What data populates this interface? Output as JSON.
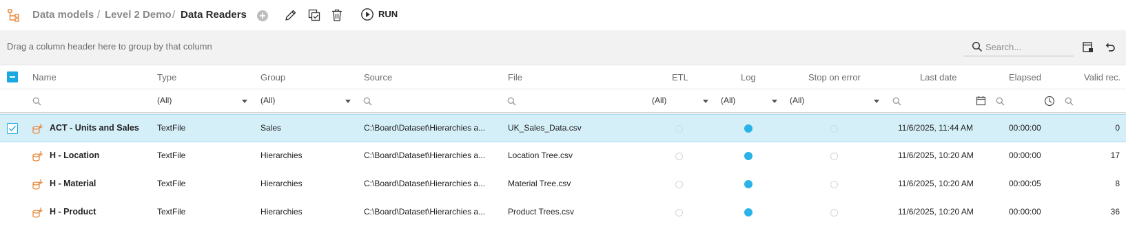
{
  "breadcrumb": {
    "items": [
      "Data models",
      "Level 2 Demo",
      "Data Readers"
    ],
    "separator": "/"
  },
  "toolbar": {
    "run_label": "RUN"
  },
  "groupbar": {
    "hint": "Drag a column header here to group by that column",
    "search_placeholder": "Search..."
  },
  "columns": {
    "name": "Name",
    "type": "Type",
    "group": "Group",
    "source": "Source",
    "file": "File",
    "etl": "ETL",
    "log": "Log",
    "stop_on_error": "Stop on error",
    "last_date": "Last date",
    "elapsed": "Elapsed",
    "valid_rec": "Valid rec."
  },
  "filters": {
    "type": "(All)",
    "group": "(All)",
    "etl": "(All)",
    "log": "(All)",
    "stop_on_error": "(All)"
  },
  "rows": [
    {
      "name": "ACT - Units and Sales",
      "type": "TextFile",
      "group": "Sales",
      "source": "C:\\Board\\Dataset\\Hierarchies a...",
      "file": "UK_Sales_Data.csv",
      "etl": false,
      "log": true,
      "stop_on_error": false,
      "last_date": "11/6/2025, 11:44 AM",
      "elapsed": "00:00:00",
      "valid_rec": "0",
      "selected": true
    },
    {
      "name": "H - Location",
      "type": "TextFile",
      "group": "Hierarchies",
      "source": "C:\\Board\\Dataset\\Hierarchies a...",
      "file": "Location Tree.csv",
      "etl": false,
      "log": true,
      "stop_on_error": false,
      "last_date": "11/6/2025, 10:20 AM",
      "elapsed": "00:00:00",
      "valid_rec": "17",
      "selected": false
    },
    {
      "name": "H - Material",
      "type": "TextFile",
      "group": "Hierarchies",
      "source": "C:\\Board\\Dataset\\Hierarchies a...",
      "file": "Material Tree.csv",
      "etl": false,
      "log": true,
      "stop_on_error": false,
      "last_date": "11/6/2025, 10:20 AM",
      "elapsed": "00:00:05",
      "valid_rec": "8",
      "selected": false
    },
    {
      "name": "H - Product",
      "type": "TextFile",
      "group": "Hierarchies",
      "source": "C:\\Board\\Dataset\\Hierarchies a...",
      "file": "Product Trees.csv",
      "etl": false,
      "log": true,
      "stop_on_error": false,
      "last_date": "11/6/2025, 10:20 AM",
      "elapsed": "00:00:00",
      "valid_rec": "36",
      "selected": false
    }
  ],
  "colors": {
    "accent": "#2bb3e8",
    "selected_row": "#d5eff9",
    "reader_icon": "#e8883a",
    "groupbar_bg": "#f2f2f2"
  },
  "icons": {
    "app": "hierarchy-icon",
    "add": "add-circle-icon",
    "edit": "pencil-icon",
    "duplicate": "duplicate-icon",
    "delete": "trash-icon",
    "run": "play-circle-icon",
    "search": "search-icon",
    "column_chooser": "column-chooser-icon",
    "undo": "undo-icon",
    "reader": "data-reader-icon"
  }
}
